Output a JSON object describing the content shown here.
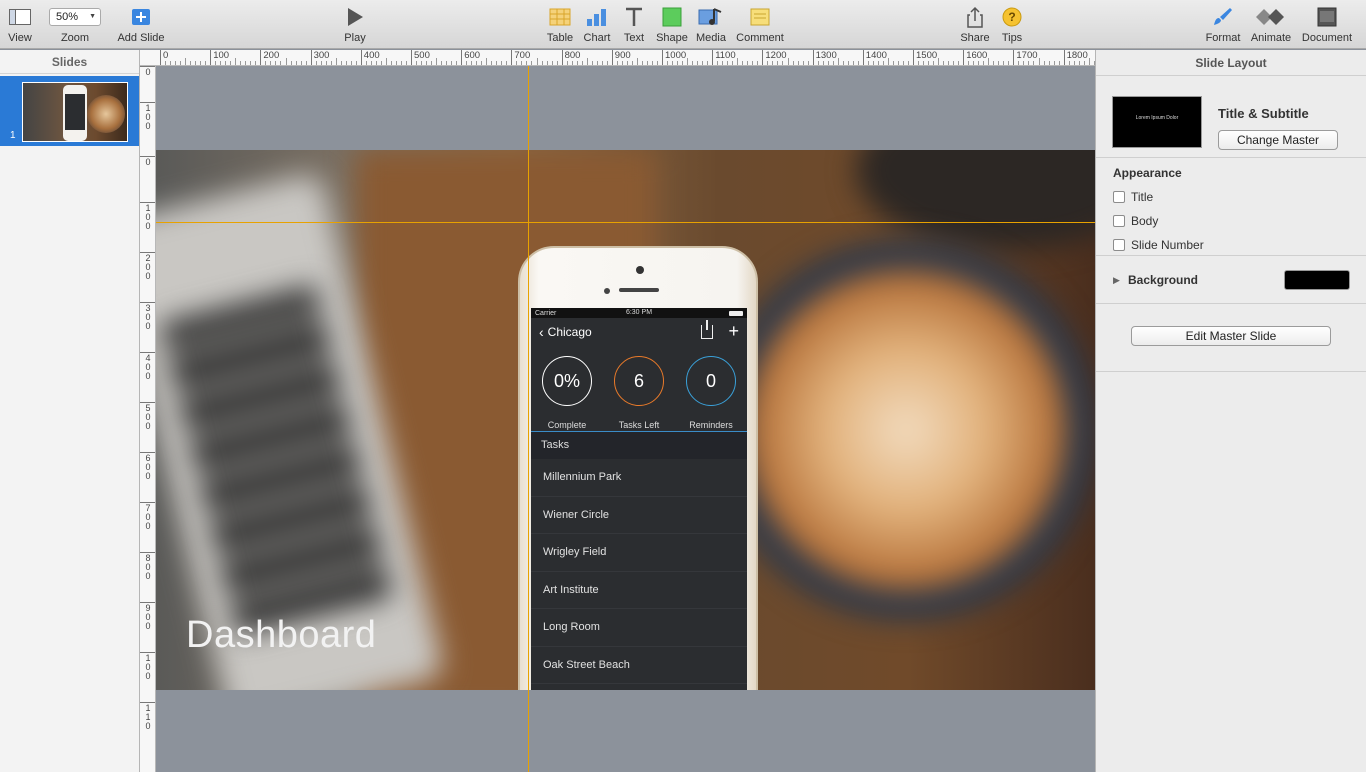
{
  "toolbar": {
    "view": "View",
    "zoom_value": "50%",
    "zoom": "Zoom",
    "add_slide": "Add Slide",
    "play": "Play",
    "table": "Table",
    "chart": "Chart",
    "text": "Text",
    "shape": "Shape",
    "media": "Media",
    "comment": "Comment",
    "share": "Share",
    "tips": "Tips",
    "format": "Format",
    "animate": "Animate",
    "document": "Document"
  },
  "slides_panel": {
    "header": "Slides",
    "slide_number": "1"
  },
  "ruler_top": [
    "0",
    "100",
    "200",
    "300",
    "400",
    "500",
    "600",
    "700",
    "800",
    "900",
    "1000",
    "1100",
    "1200",
    "1300",
    "1400",
    "1500",
    "1600",
    "1700",
    "1800"
  ],
  "ruler_left": [
    "0",
    "1 0 0",
    "0",
    "1 0 0",
    "2 0 0",
    "3 0 0",
    "4 0 0",
    "5 0 0",
    "6 0 0",
    "7 0 0",
    "8 0 0",
    "9 0 0",
    "1 0 0",
    "1 1 0"
  ],
  "slide": {
    "title": "Dashboard",
    "phone": {
      "carrier": "Carrier",
      "time": "6:30 PM",
      "nav_title": "Chicago",
      "stats": [
        {
          "value": "0%",
          "label": "Complete",
          "ring_color": "#ffffff"
        },
        {
          "value": "6",
          "label": "Tasks Left",
          "ring_color": "#e87a2a"
        },
        {
          "value": "0",
          "label": "Reminders",
          "ring_color": "#3aa0d8"
        }
      ],
      "tasks_header": "Tasks",
      "tasks": [
        "Millennium Park",
        "Wiener Circle",
        "Wrigley Field",
        "Art Institute",
        "Long Room",
        "Oak Street Beach"
      ]
    }
  },
  "inspector": {
    "title": "Slide Layout",
    "master_thumb_text": "Lorem Ipsum Dolor",
    "master_name": "Title & Subtitle",
    "change_master": "Change Master",
    "appearance": "Appearance",
    "checkboxes": [
      "Title",
      "Body",
      "Slide Number"
    ],
    "background": "Background",
    "background_color": "#000000",
    "edit_master": "Edit Master Slide"
  },
  "colors": {
    "guide": "#e8a200",
    "selection": "#2a7ad6"
  }
}
